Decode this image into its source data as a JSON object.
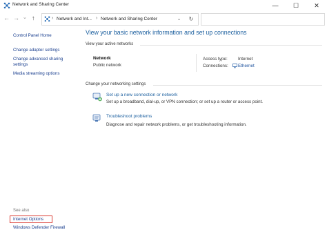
{
  "window": {
    "title": "Network and Sharing Center",
    "controls": {
      "minimize": "—",
      "maximize": "☐",
      "close": "✕"
    }
  },
  "address": {
    "nav_back": "←",
    "nav_forward": "→",
    "nav_recent": "⌄",
    "nav_up": "↑",
    "breadcrumbs": [
      "Network and Int...",
      "Network and Sharing Center"
    ],
    "dropdown": "⌄",
    "refresh": "↻"
  },
  "sidebar": {
    "items": [
      {
        "label": "Control Panel Home"
      },
      {
        "label": "Change adapter settings"
      },
      {
        "label": "Change advanced sharing"
      },
      {
        "label": "settings"
      },
      {
        "label": "Media streaming options"
      }
    ],
    "see_also_heading": "See also",
    "see_also_items": [
      {
        "label": "Internet Options"
      },
      {
        "label": "Windows Defender Firewall"
      }
    ]
  },
  "main": {
    "title": "View your basic network information and set up connections",
    "active_networks_label": "View your active networks",
    "network": {
      "name": "Network",
      "category": "Public network",
      "access_type_label": "Access type:",
      "access_type_value": "Internet",
      "connections_label": "Connections:",
      "connections_value": "Ethernet"
    },
    "change_settings_label": "Change your networking settings",
    "tasks": [
      {
        "link": "Set up a new connection or network",
        "desc": "Set up a broadband, dial-up, or VPN connection; or set up a router or access point."
      },
      {
        "link": "Troubleshoot problems",
        "desc": "Diagnose and repair network problems, or get troubleshooting information."
      }
    ]
  },
  "colors": {
    "link": "#1a3f8f",
    "title": "#1a5e9e",
    "highlight": "#d9382f"
  }
}
